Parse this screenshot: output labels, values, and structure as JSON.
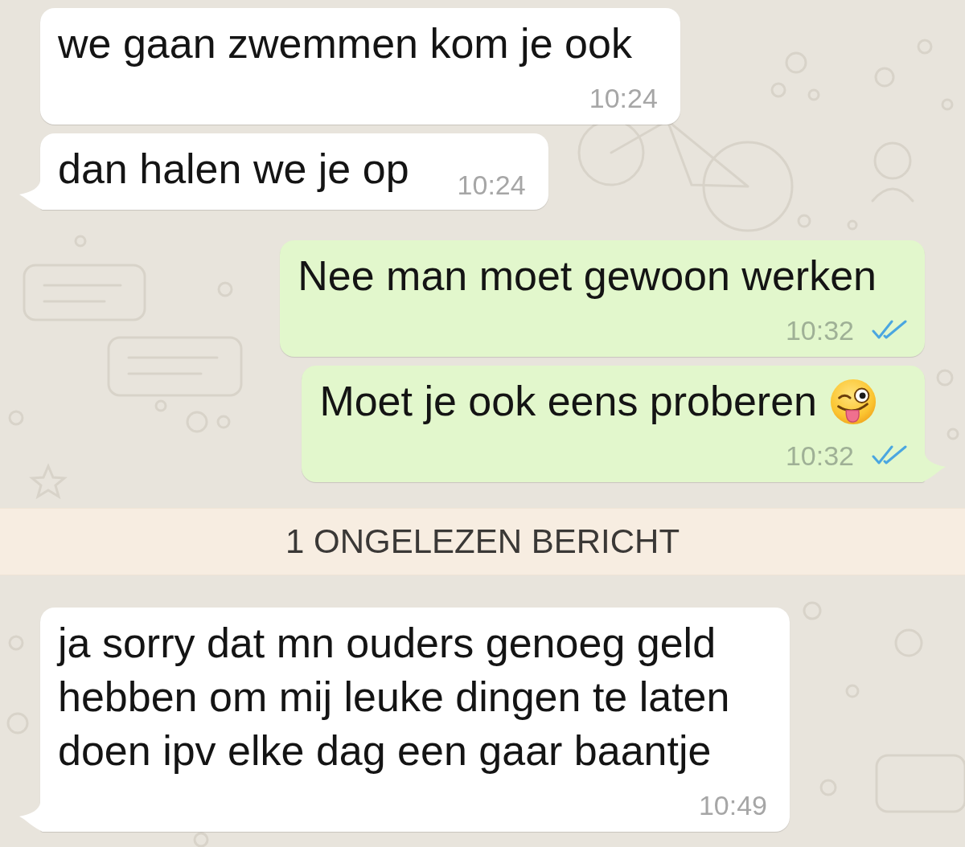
{
  "chat": [
    {
      "kind": "incoming",
      "text": "we gaan zwemmen kom je ook",
      "emoji": false,
      "time": "10:24",
      "time_inline": false,
      "tail": false
    },
    {
      "kind": "incoming",
      "text": "dan halen we je op",
      "emoji": false,
      "time": "10:24",
      "time_inline": true,
      "tail": true
    },
    {
      "kind": "outgoing",
      "text": "Nee man moet gewoon werken",
      "emoji": false,
      "time": "10:32",
      "time_inline": false,
      "tail": false,
      "read": true
    },
    {
      "kind": "outgoing",
      "text": "Moet je ook eens proberen",
      "emoji": true,
      "time": "10:32",
      "time_inline": false,
      "tail": true,
      "read": true
    },
    {
      "kind": "unread_divider",
      "text": "1 ONGELEZEN BERICHT"
    },
    {
      "kind": "incoming",
      "text": "ja sorry dat mn ouders genoeg geld hebben om mij leuke dingen te laten doen ipv elke dag een gaar baantje",
      "emoji": false,
      "time": "10:49",
      "time_inline": false,
      "tail": true
    }
  ]
}
